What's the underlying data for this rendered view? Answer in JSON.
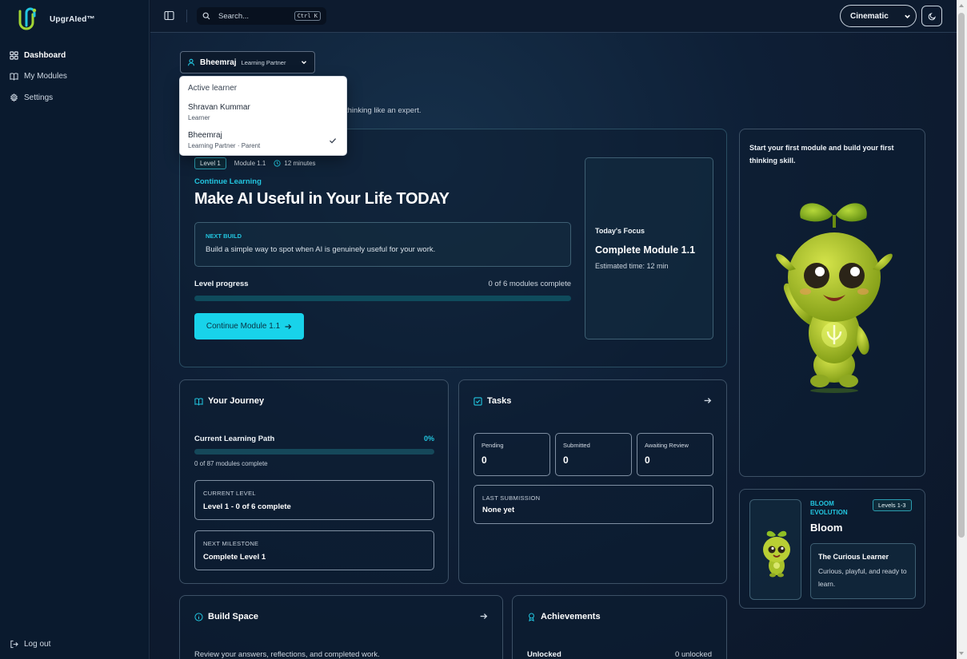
{
  "sidebar": {
    "brand": "UpgrAIed™",
    "items": [
      {
        "label": "Dashboard",
        "icon": "dashboard-grid-icon",
        "active": true
      },
      {
        "label": "My Modules",
        "icon": "book-open-icon",
        "active": false
      },
      {
        "label": "Settings",
        "icon": "gear-icon",
        "active": false
      }
    ],
    "logout_label": "Log out"
  },
  "topbar": {
    "search_placeholder": "Search...",
    "search_shortcut": "Ctrl K",
    "theme_value": "Cinematic",
    "mode_icon": "moon-icon"
  },
  "learner_switch": {
    "name": "Bheemraj",
    "role": "Learning Partner"
  },
  "dropdown": {
    "header": "Active learner",
    "options": [
      {
        "name": "Shravan Kummar",
        "role": "Learner",
        "selected": false
      },
      {
        "name": "Bheemraj",
        "role": "Learning Partner · Parent",
        "selected": true
      }
    ]
  },
  "subtitle_fragment": "thinking like an expert.",
  "hero": {
    "level": "Level 1",
    "module": "Module 1.1",
    "duration": "12 minutes",
    "continue_label": "Continue Learning",
    "title": "Make AI Useful in Your Life TODAY",
    "next_build_label": "NEXT BUILD",
    "next_build_text": "Build a simple way to spot when AI is genuinely useful for your work.",
    "progress_label": "Level progress",
    "progress_count": "0 of 6 modules complete",
    "progress_fraction": 0,
    "cta_label": "Continue Module 1.1",
    "focus_label": "Today's Focus",
    "focus_title": "Complete Module 1.1",
    "focus_time": "Estimated time: 12 min"
  },
  "mascot_card": {
    "text": "Start your first module and build your first thinking skill."
  },
  "journey": {
    "title": "Your Journey",
    "path_label": "Current Learning Path",
    "path_pct": "0%",
    "path_fraction": 0,
    "path_count": "0 of 87 modules complete",
    "current_level_label": "CURRENT LEVEL",
    "current_level_value": "Level 1 - 0 of 6 complete",
    "next_milestone_label": "NEXT MILESTONE",
    "next_milestone_value": "Complete Level 1"
  },
  "tasks": {
    "title": "Tasks",
    "stats": [
      {
        "label": "Pending",
        "value": "0"
      },
      {
        "label": "Submitted",
        "value": "0"
      },
      {
        "label": "Awaiting Review",
        "value": "0"
      }
    ],
    "last_submission_label": "LAST SUBMISSION",
    "last_submission_value": "None yet"
  },
  "bloom": {
    "eyebrow": "BLOOM EVOLUTION",
    "levels": "Levels 1-3",
    "name": "Bloom",
    "stage_title": "The Curious Learner",
    "stage_desc": "Curious, playful, and ready to learn."
  },
  "build_space": {
    "title": "Build Space",
    "desc": "Review your answers, reflections, and completed work."
  },
  "achievements": {
    "title": "Achievements",
    "unlocked_label": "Unlocked",
    "unlocked_count": "0 unlocked"
  },
  "colors": {
    "accent": "#22d3ee",
    "background": "#0b1628",
    "card_border": "#2a4e63"
  }
}
